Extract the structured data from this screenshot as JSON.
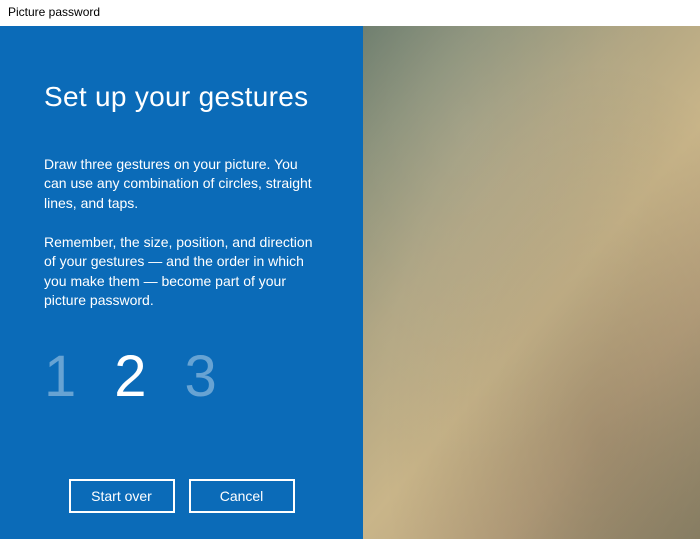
{
  "window": {
    "title": "Picture password"
  },
  "content": {
    "heading": "Set up your gestures",
    "paragraph1": "Draw three gestures on your picture. You can use any combination of circles, straight lines, and taps.",
    "paragraph2": "Remember, the size, position, and direction of your gestures — and the order in which you make them — become part of your picture password."
  },
  "steps": {
    "one": "1",
    "two": "2",
    "three": "3",
    "active_index": 1
  },
  "buttons": {
    "start_over": "Start over",
    "cancel": "Cancel"
  }
}
